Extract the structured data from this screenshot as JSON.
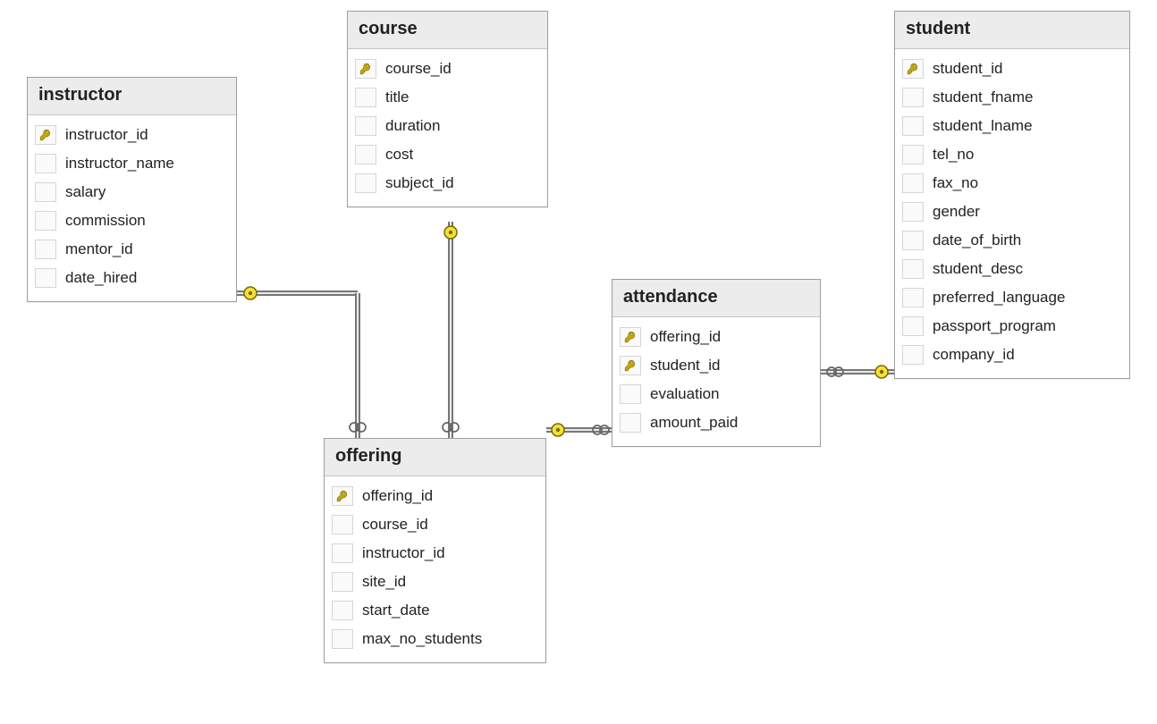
{
  "entities": {
    "instructor": {
      "title": "instructor",
      "columns": [
        {
          "name": "instructor_id",
          "pk": true
        },
        {
          "name": "instructor_name",
          "pk": false
        },
        {
          "name": "salary",
          "pk": false
        },
        {
          "name": "commission",
          "pk": false
        },
        {
          "name": "mentor_id",
          "pk": false
        },
        {
          "name": "date_hired",
          "pk": false
        }
      ]
    },
    "course": {
      "title": "course",
      "columns": [
        {
          "name": "course_id",
          "pk": true
        },
        {
          "name": "title",
          "pk": false
        },
        {
          "name": "duration",
          "pk": false
        },
        {
          "name": "cost",
          "pk": false
        },
        {
          "name": "subject_id",
          "pk": false
        }
      ]
    },
    "offering": {
      "title": "offering",
      "columns": [
        {
          "name": "offering_id",
          "pk": true
        },
        {
          "name": "course_id",
          "pk": false
        },
        {
          "name": "instructor_id",
          "pk": false
        },
        {
          "name": "site_id",
          "pk": false
        },
        {
          "name": "start_date",
          "pk": false
        },
        {
          "name": "max_no_students",
          "pk": false
        }
      ]
    },
    "attendance": {
      "title": "attendance",
      "columns": [
        {
          "name": "offering_id",
          "pk": true
        },
        {
          "name": "student_id",
          "pk": true
        },
        {
          "name": "evaluation",
          "pk": false
        },
        {
          "name": "amount_paid",
          "pk": false
        }
      ]
    },
    "student": {
      "title": "student",
      "columns": [
        {
          "name": "student_id",
          "pk": true
        },
        {
          "name": "student_fname",
          "pk": false
        },
        {
          "name": "student_lname",
          "pk": false
        },
        {
          "name": "tel_no",
          "pk": false
        },
        {
          "name": "fax_no",
          "pk": false
        },
        {
          "name": "gender",
          "pk": false
        },
        {
          "name": "date_of_birth",
          "pk": false
        },
        {
          "name": "student_desc",
          "pk": false
        },
        {
          "name": "preferred_language",
          "pk": false
        },
        {
          "name": "passport_program",
          "pk": false
        },
        {
          "name": "company_id",
          "pk": false
        }
      ]
    }
  },
  "relationships": [
    {
      "from": "instructor",
      "to": "offering",
      "one_side": "instructor",
      "many_side": "offering"
    },
    {
      "from": "course",
      "to": "offering",
      "one_side": "course",
      "many_side": "offering"
    },
    {
      "from": "offering",
      "to": "attendance",
      "one_side": "offering",
      "many_side": "attendance"
    },
    {
      "from": "student",
      "to": "attendance",
      "one_side": "student",
      "many_side": "attendance"
    }
  ],
  "colors": {
    "key_fill": "#c9a900",
    "key_endpoint": "#f4e03a",
    "border": "#9d9d9d",
    "header_bg": "#ececec"
  }
}
